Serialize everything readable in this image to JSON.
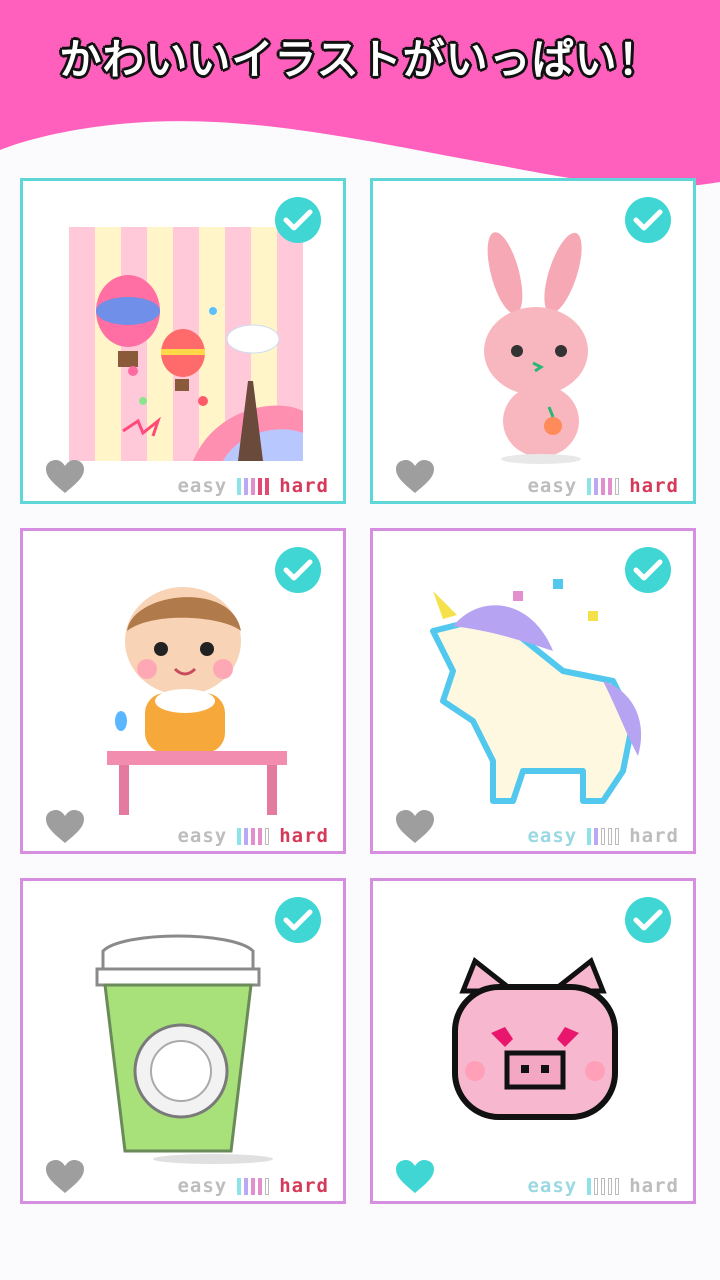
{
  "banner": {
    "title": "かわいいイラストがいっぱい！",
    "color": "#ff5fbd"
  },
  "cards": [
    {
      "art": "paris-balloons",
      "completed": true,
      "favorite": false,
      "easy_label": "easy",
      "hard_label": "hard",
      "difficulty": 4
    },
    {
      "art": "pink-bunny",
      "completed": true,
      "favorite": false,
      "easy_label": "easy",
      "hard_label": "hard",
      "difficulty": 4
    },
    {
      "art": "baby-at-table",
      "completed": true,
      "favorite": false,
      "easy_label": "easy",
      "hard_label": "hard",
      "difficulty": 3
    },
    {
      "art": "pastel-unicorn",
      "completed": true,
      "favorite": false,
      "easy_label": "easy",
      "hard_label": "hard",
      "difficulty": 2
    },
    {
      "art": "green-drink-cup",
      "completed": true,
      "favorite": false,
      "easy_label": "easy",
      "hard_label": "hard",
      "difficulty": 3
    },
    {
      "art": "pink-pig-face",
      "completed": true,
      "favorite": true,
      "easy_label": "easy",
      "hard_label": "hard",
      "difficulty": 1
    }
  ],
  "icons": {
    "check": "check-icon",
    "heart": "heart-icon"
  },
  "colors": {
    "accent": "#3fd6d4",
    "heart_off": "#9e9e9e",
    "heart_on": "#3fd6d4",
    "hard": "#d63a5a"
  }
}
